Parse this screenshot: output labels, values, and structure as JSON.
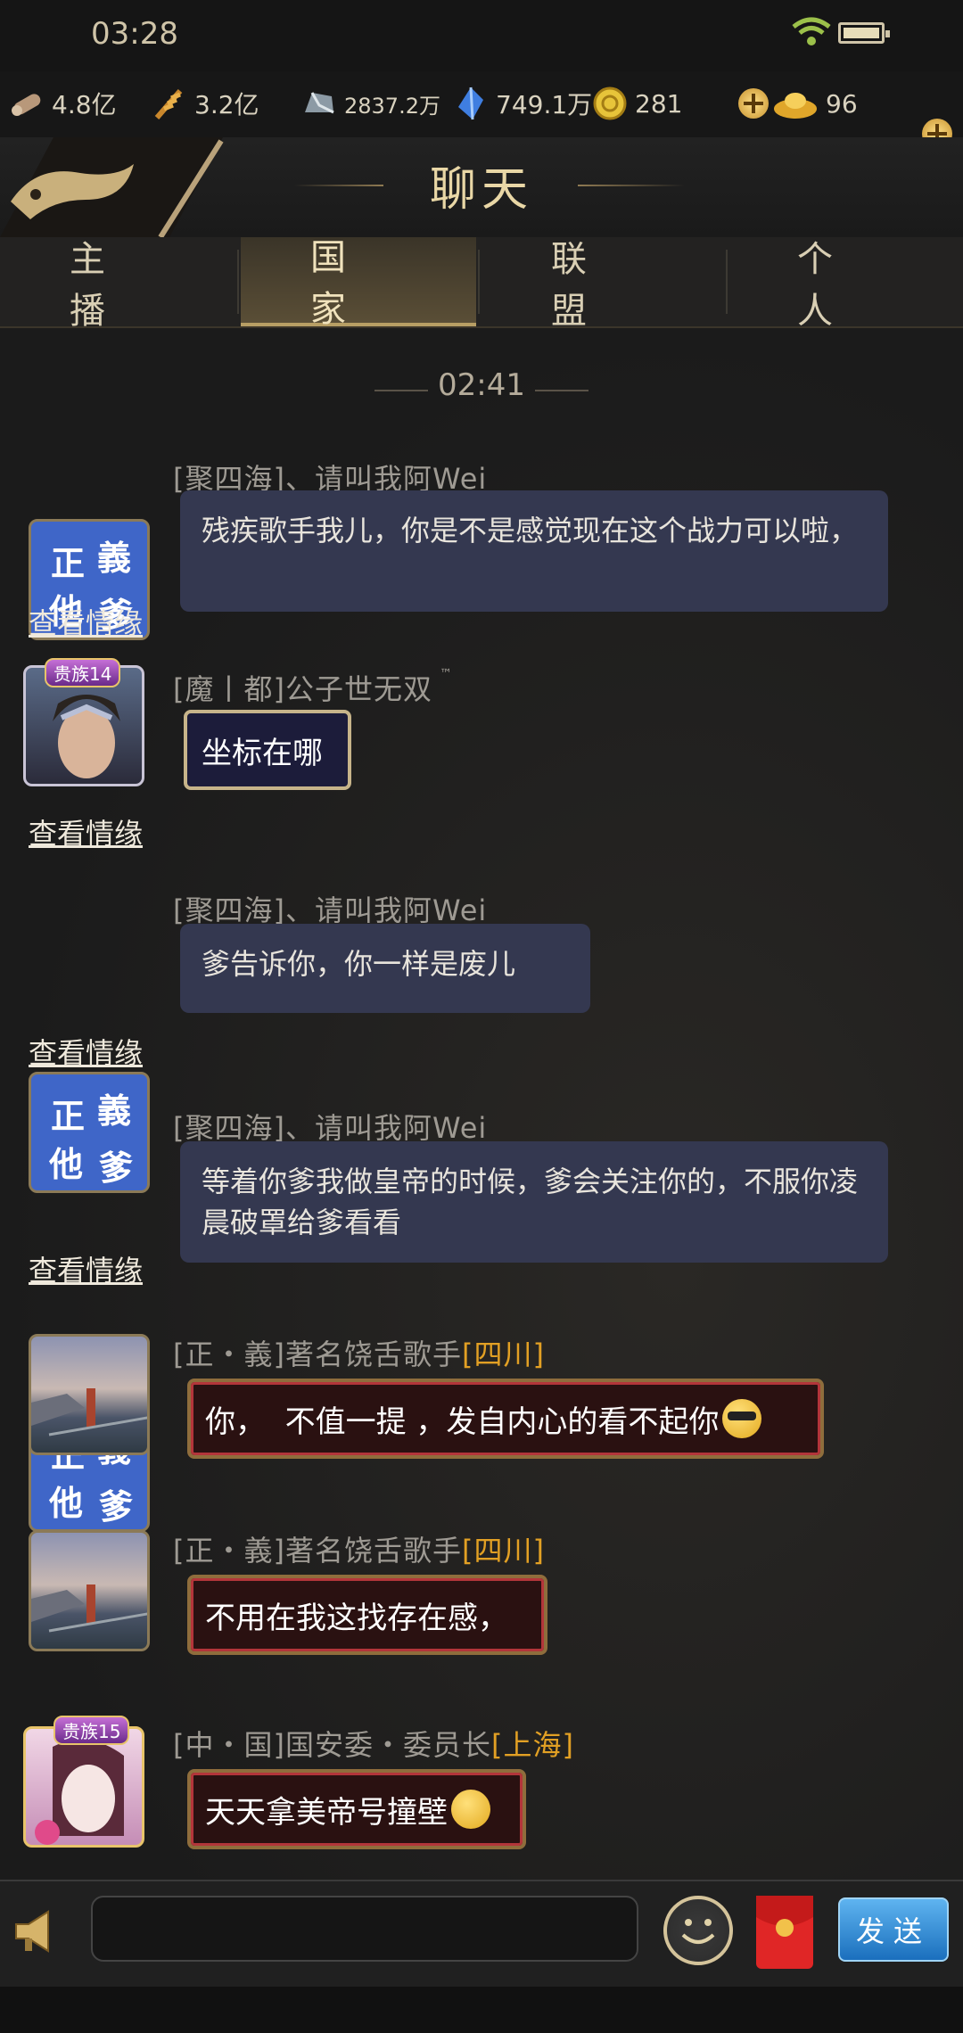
{
  "status": {
    "time": "03:28"
  },
  "resources": [
    {
      "icon": "wood-icon",
      "value": "4.8亿"
    },
    {
      "icon": "grain-icon",
      "value": "3.2亿"
    },
    {
      "icon": "iron-icon",
      "value": "2837.2万"
    },
    {
      "icon": "crystal-icon",
      "value": "749.1万"
    },
    {
      "icon": "coin-icon",
      "value": "281"
    },
    {
      "icon": "ingot-icon",
      "value": "96"
    }
  ],
  "header": {
    "title": "聊天"
  },
  "tabs": [
    {
      "label": "主播",
      "active": false
    },
    {
      "label": "国家",
      "active": true
    },
    {
      "label": "联盟",
      "active": false
    },
    {
      "label": "个人",
      "active": false
    }
  ],
  "chat": {
    "timestamp": "02:41",
    "view_relationship_label": "查看情缘",
    "avatar_text": [
      "正",
      "義",
      "他",
      "爹"
    ],
    "messages": [
      {
        "sender": "[聚四海]、请叫我阿Wei",
        "text": "残疾歌手我儿，你是不是感觉现在这个战力可以啦，"
      },
      {
        "sender": "[魔丨都]公子世无双",
        "sender_suffix": "™",
        "badge": "贵族14",
        "text": "坐标在哪"
      },
      {
        "sender": "[聚四海]、请叫我阿Wei",
        "text": "爹告诉你，你一样是废儿"
      },
      {
        "sender": "[聚四海]、请叫我阿Wei",
        "text": "等着你爹我做皇帝的时候，爹会关注你的，不服你凌晨破罩给爹看看"
      },
      {
        "sender": "[正・義]著名饶舌歌手",
        "location": "[四川]",
        "text": "你，  不值一提 ，发自内心的看不起你"
      },
      {
        "sender": "[正・義]著名饶舌歌手",
        "location": "[四川]",
        "text": "不用在我这找存在感，"
      },
      {
        "sender": "[中・国]国安委・委员长",
        "location": "[上海]",
        "badge": "贵族15",
        "text": "天天拿美帝号撞壁"
      }
    ]
  },
  "input": {
    "placeholder": "",
    "send_label": "发送"
  },
  "colors": {
    "accent_gold": "#e9d7a6",
    "bubble": "#343850",
    "location": "#e2a024",
    "send_button": "#2a86d2"
  }
}
